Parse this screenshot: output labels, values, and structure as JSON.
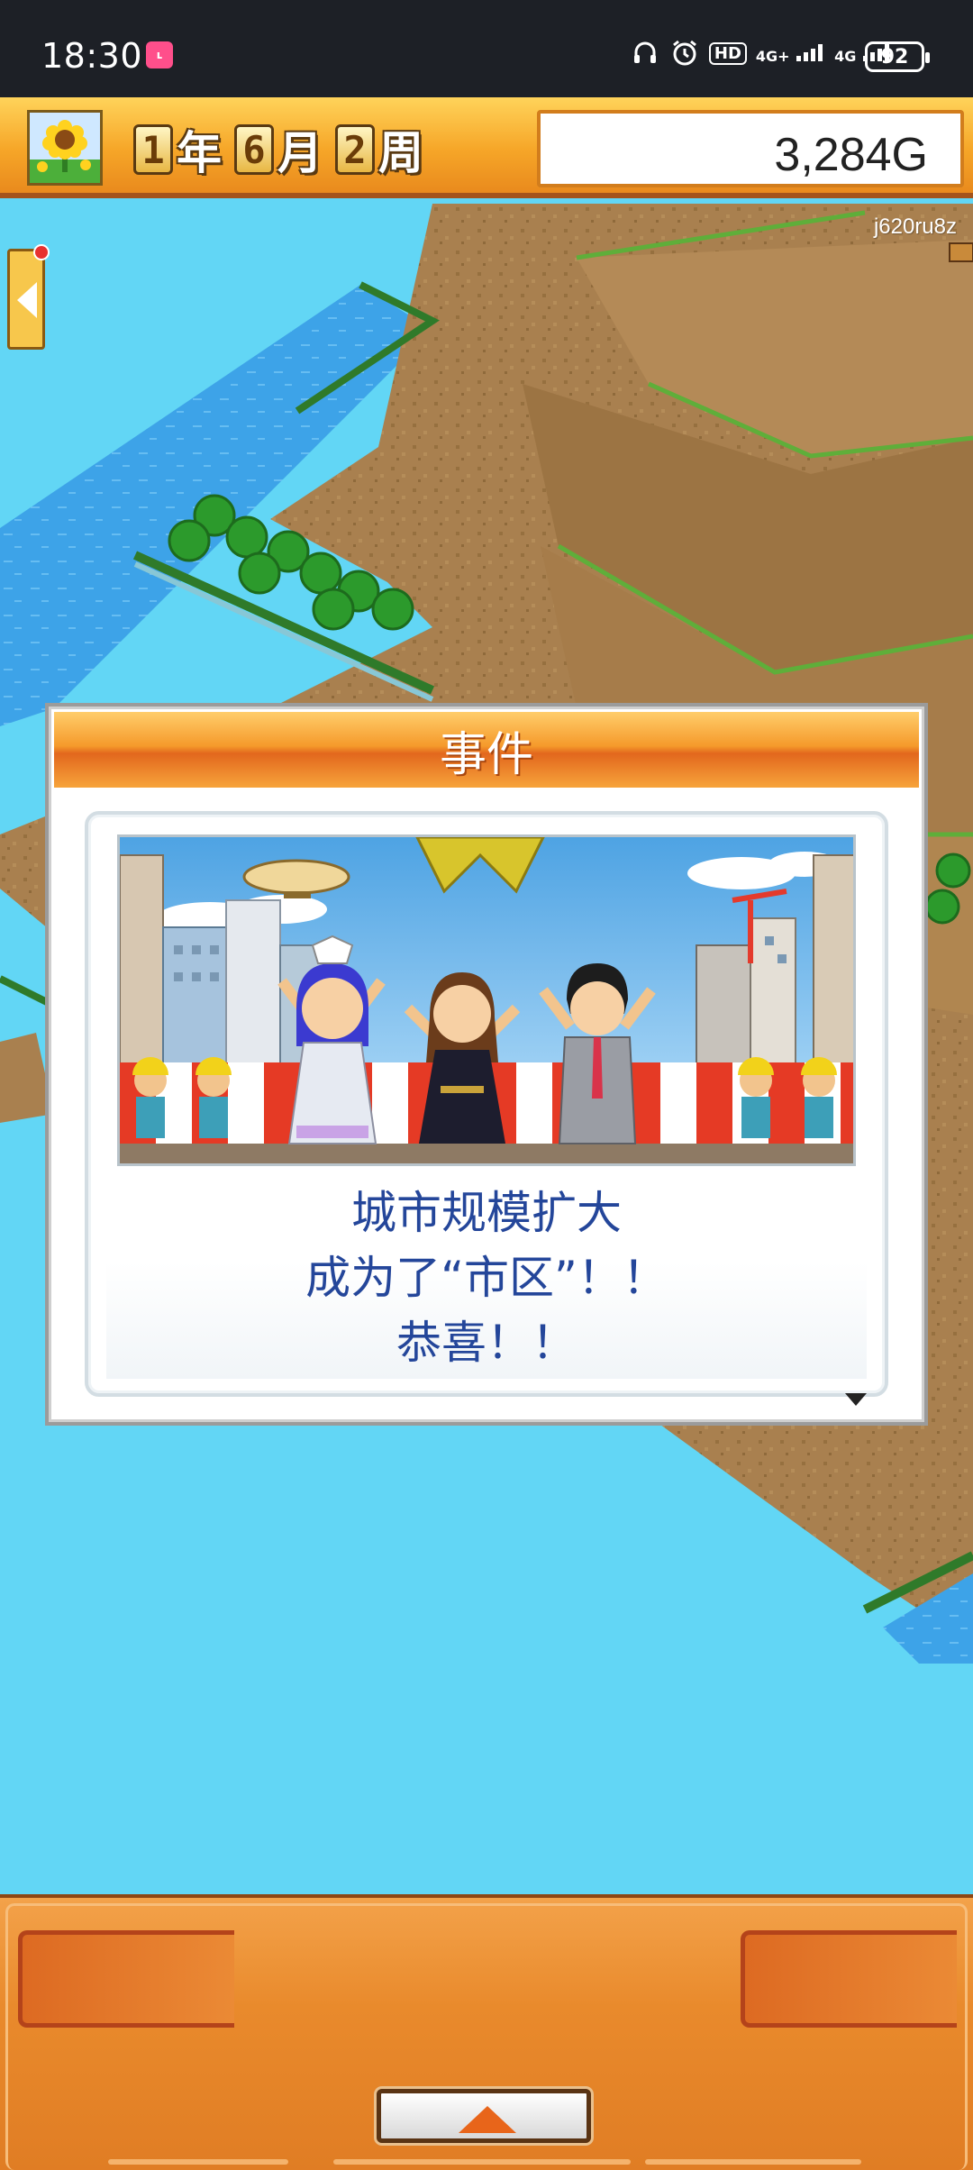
{
  "status_bar": {
    "time": "18:30",
    "app_icon": "app-notification-icon",
    "hd_label": "HD",
    "signal_1": "4G+",
    "signal_2": "4G",
    "battery": "92"
  },
  "game_header": {
    "year_num": "1",
    "year_unit": "年",
    "month_num": "6",
    "month_unit": "月",
    "week_num": "2",
    "week_unit": "周",
    "money": "3,284G"
  },
  "map": {
    "player_id": "j620ru8z"
  },
  "event_dialog": {
    "title": "事件",
    "message_lines": [
      "城市规模扩大",
      "成为了“市区”！！",
      "恭喜！！"
    ]
  },
  "colors": {
    "water": "#62d6f5",
    "title_bar": "#f6a628",
    "dialog_text": "#24469a",
    "bottom_panel": "#e98a2c"
  }
}
